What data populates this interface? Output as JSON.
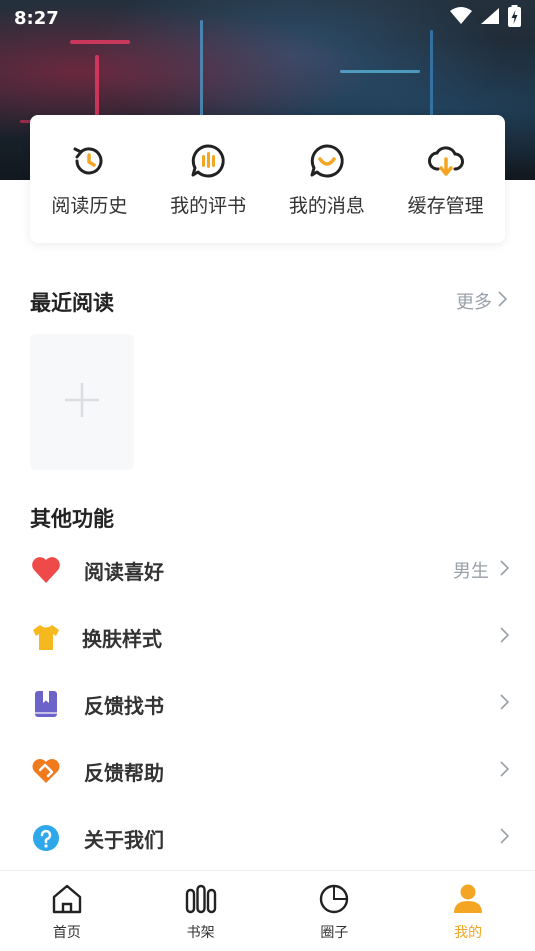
{
  "status_bar": {
    "time": "8:27"
  },
  "quick_actions": [
    {
      "label": "阅读历史",
      "icon": "history-icon"
    },
    {
      "label": "我的评书",
      "icon": "review-bubble-icon"
    },
    {
      "label": "我的消息",
      "icon": "message-smile-icon"
    },
    {
      "label": "缓存管理",
      "icon": "cloud-download-icon"
    }
  ],
  "recent": {
    "title": "最近阅读",
    "more_label": "更多"
  },
  "other": {
    "title": "其他功能",
    "items": [
      {
        "label": "阅读喜好",
        "value": "男生",
        "icon": "heart-icon"
      },
      {
        "label": "换肤样式",
        "value": "",
        "icon": "shirt-icon"
      },
      {
        "label": "反馈找书",
        "value": "",
        "icon": "book-icon"
      },
      {
        "label": "反馈帮助",
        "value": "",
        "icon": "handshake-icon"
      },
      {
        "label": "关于我们",
        "value": "",
        "icon": "question-icon"
      }
    ]
  },
  "nav": {
    "items": [
      {
        "label": "首页",
        "icon": "home-icon"
      },
      {
        "label": "书架",
        "icon": "bookshelf-icon"
      },
      {
        "label": "圈子",
        "icon": "circle-icon"
      },
      {
        "label": "我的",
        "icon": "profile-icon"
      }
    ],
    "active": "我的"
  },
  "colors": {
    "accent": "#f5a524",
    "heart": "#ef4a4a",
    "book": "#6c63c8",
    "help": "#f07a1e",
    "about": "#2ea8ea"
  }
}
